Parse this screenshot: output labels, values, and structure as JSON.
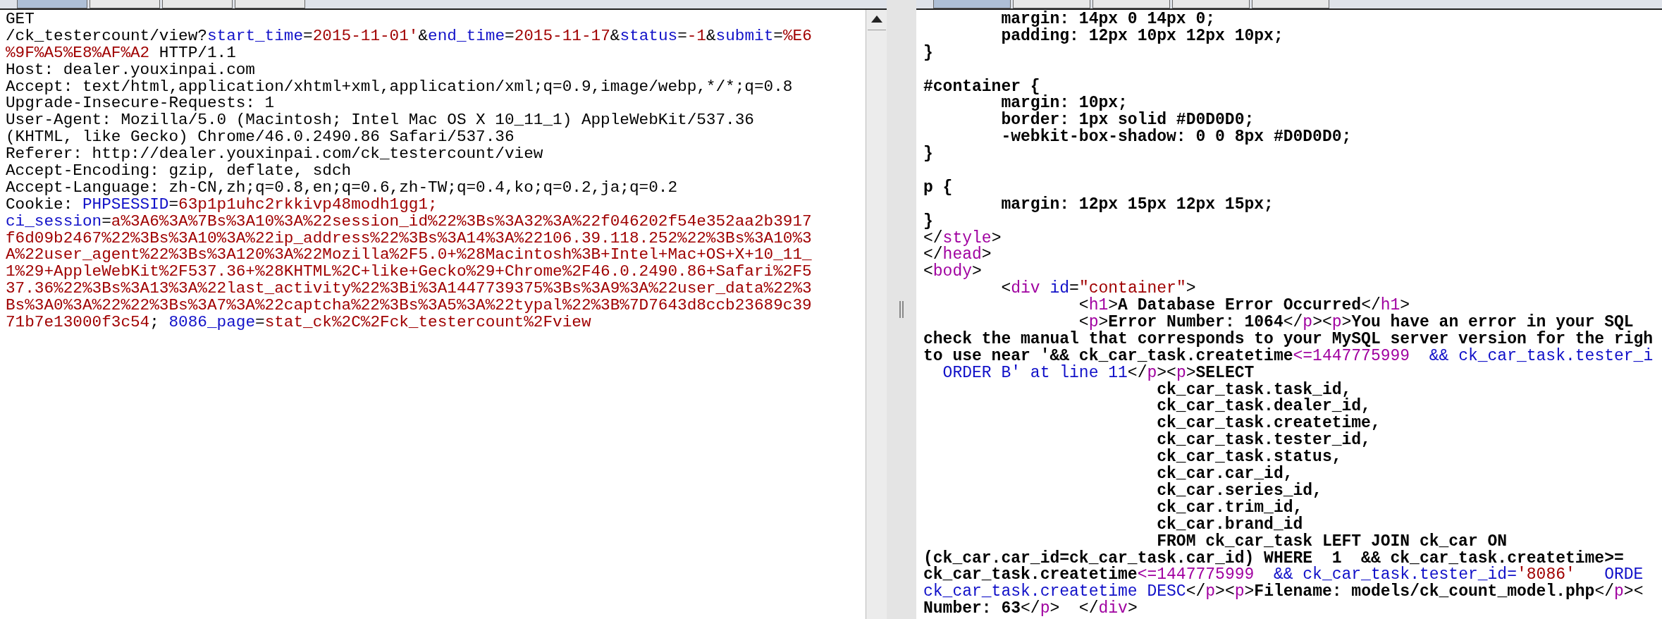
{
  "request_pane": {
    "tabs": [
      {
        "selected": true
      },
      {
        "selected": false
      },
      {
        "selected": false
      },
      {
        "selected": false
      }
    ],
    "lines": [
      {
        "segments": [
          {
            "kind": "text",
            "text": "GET"
          }
        ]
      },
      {
        "segments": [
          {
            "kind": "text",
            "text": "/ck_testercount/view?"
          },
          {
            "kind": "name",
            "text": "start_time"
          },
          {
            "kind": "text",
            "text": "="
          },
          {
            "kind": "value",
            "text": "2015-11-01'"
          },
          {
            "kind": "text",
            "text": "&"
          },
          {
            "kind": "name",
            "text": "end_time"
          },
          {
            "kind": "text",
            "text": "="
          },
          {
            "kind": "value",
            "text": "2015-11-17"
          },
          {
            "kind": "text",
            "text": "&"
          },
          {
            "kind": "name",
            "text": "status"
          },
          {
            "kind": "text",
            "text": "="
          },
          {
            "kind": "value",
            "text": "-1"
          },
          {
            "kind": "text",
            "text": "&"
          },
          {
            "kind": "name",
            "text": "submit"
          },
          {
            "kind": "text",
            "text": "="
          },
          {
            "kind": "value",
            "text": "%E6"
          }
        ]
      },
      {
        "segments": [
          {
            "kind": "value",
            "text": "%9F%A5%E8%AF%A2"
          },
          {
            "kind": "text",
            "text": " HTTP/1.1"
          }
        ]
      },
      {
        "segments": [
          {
            "kind": "text",
            "text": "Host: dealer.youxinpai.com"
          }
        ]
      },
      {
        "segments": [
          {
            "kind": "text",
            "text": "Accept: text/html,application/xhtml+xml,application/xml;q=0.9,image/webp,*/*;q=0.8"
          }
        ]
      },
      {
        "segments": [
          {
            "kind": "text",
            "text": "Upgrade-Insecure-Requests: 1"
          }
        ]
      },
      {
        "segments": [
          {
            "kind": "text",
            "text": "User-Agent: Mozilla/5.0 (Macintosh; Intel Mac OS X 10_11_1) AppleWebKit/537.36"
          }
        ]
      },
      {
        "segments": [
          {
            "kind": "text",
            "text": "(KHTML, like Gecko) Chrome/46.0.2490.86 Safari/537.36"
          }
        ]
      },
      {
        "segments": [
          {
            "kind": "text",
            "text": "Referer: http://dealer.youxinpai.com/ck_testercount/view"
          }
        ]
      },
      {
        "segments": [
          {
            "kind": "text",
            "text": "Accept-Encoding: gzip, deflate, sdch"
          }
        ]
      },
      {
        "segments": [
          {
            "kind": "text",
            "text": "Accept-Language: zh-CN,zh;q=0.8,en;q=0.6,zh-TW;q=0.4,ko;q=0.2,ja;q=0.2"
          }
        ]
      },
      {
        "segments": [
          {
            "kind": "text",
            "text": "Cookie: "
          },
          {
            "kind": "name",
            "text": "PHPSESSID"
          },
          {
            "kind": "text",
            "text": "="
          },
          {
            "kind": "value",
            "text": "63p1p1uhc2rkkivp48modh1gg1;"
          }
        ]
      },
      {
        "segments": [
          {
            "kind": "name",
            "text": "ci_session"
          },
          {
            "kind": "text",
            "text": "="
          },
          {
            "kind": "value",
            "text": "a%3A6%3A%7Bs%3A10%3A%22session_id%22%3Bs%3A32%3A%22f046202f54e352aa2b3917"
          }
        ]
      },
      {
        "segments": [
          {
            "kind": "value",
            "text": "f6d09b2467%22%3Bs%3A10%3A%22ip_address%22%3Bs%3A14%3A%22106.39.118.252%22%3Bs%3A10%3"
          }
        ]
      },
      {
        "segments": [
          {
            "kind": "value",
            "text": "A%22user_agent%22%3Bs%3A120%3A%22Mozilla%2F5.0+%28Macintosh%3B+Intel+Mac+OS+X+10_11_"
          }
        ]
      },
      {
        "segments": [
          {
            "kind": "value",
            "text": "1%29+AppleWebKit%2F537.36+%28KHTML%2C+like+Gecko%29+Chrome%2F46.0.2490.86+Safari%2F5"
          }
        ]
      },
      {
        "segments": [
          {
            "kind": "value",
            "text": "37.36%22%3Bs%3A13%3A%22last_activity%22%3Bi%3A1447739375%3Bs%3A9%3A%22user_data%22%3"
          }
        ]
      },
      {
        "segments": [
          {
            "kind": "value",
            "text": "Bs%3A0%3A%22%22%3Bs%3A7%3A%22captcha%22%3Bs%3A5%3A%22typal%22%3B%7D7643d8ccb23689c39"
          }
        ]
      },
      {
        "segments": [
          {
            "kind": "value",
            "text": "71b7e13000f3c54"
          },
          {
            "kind": "text",
            "text": "; "
          },
          {
            "kind": "name",
            "text": "8086_page"
          },
          {
            "kind": "text",
            "text": "="
          },
          {
            "kind": "value",
            "text": "stat_ck%2C%2Fck_testercount%2Fview"
          }
        ]
      }
    ]
  },
  "response_pane": {
    "tabs": [
      {
        "selected": true
      },
      {
        "selected": false
      },
      {
        "selected": false
      },
      {
        "selected": false
      },
      {
        "selected": false
      }
    ],
    "lines": [
      {
        "segments": [
          {
            "kind": "bold",
            "text": "        margin: 14px 0 14px 0;"
          }
        ]
      },
      {
        "segments": [
          {
            "kind": "bold",
            "text": "        padding: 12px 10px 12px 10px;"
          }
        ]
      },
      {
        "segments": [
          {
            "kind": "bold",
            "text": "}"
          }
        ]
      },
      {
        "space_before": true,
        "segments": [
          {
            "kind": "bold",
            "text": "#container {"
          }
        ]
      },
      {
        "segments": [
          {
            "kind": "bold",
            "text": "        margin: 10px;"
          }
        ]
      },
      {
        "segments": [
          {
            "kind": "bold",
            "text": "        border: 1px solid #D0D0D0;"
          }
        ]
      },
      {
        "segments": [
          {
            "kind": "bold",
            "text": "        -webkit-box-shadow: 0 0 8px #D0D0D0;"
          }
        ]
      },
      {
        "segments": [
          {
            "kind": "bold",
            "text": "}"
          }
        ]
      },
      {
        "space_before": true,
        "segments": [
          {
            "kind": "bold",
            "text": "p {"
          }
        ]
      },
      {
        "segments": [
          {
            "kind": "bold",
            "text": "        margin: 12px 15px 12px 15px;"
          }
        ]
      },
      {
        "segments": [
          {
            "kind": "bold",
            "text": "}"
          }
        ]
      },
      {
        "segments": [
          {
            "kind": "text",
            "text": "</"
          },
          {
            "kind": "tag",
            "text": "style"
          },
          {
            "kind": "text",
            "text": ">"
          }
        ]
      },
      {
        "segments": [
          {
            "kind": "text",
            "text": "</"
          },
          {
            "kind": "tag",
            "text": "head"
          },
          {
            "kind": "text",
            "text": ">"
          }
        ]
      },
      {
        "segments": [
          {
            "kind": "text",
            "text": "<"
          },
          {
            "kind": "tag",
            "text": "body"
          },
          {
            "kind": "text",
            "text": ">"
          }
        ]
      },
      {
        "segments": [
          {
            "kind": "text",
            "text": "        <"
          },
          {
            "kind": "tag",
            "text": "div"
          },
          {
            "kind": "name",
            "text": " id"
          },
          {
            "kind": "text",
            "text": "="
          },
          {
            "kind": "value",
            "text": "\"container\""
          },
          {
            "kind": "text",
            "text": ">"
          }
        ]
      },
      {
        "segments": [
          {
            "kind": "text",
            "text": "                <"
          },
          {
            "kind": "tag",
            "text": "h1"
          },
          {
            "kind": "text",
            "text": ">"
          },
          {
            "kind": "bold",
            "text": "A Database Error Occurred"
          },
          {
            "kind": "text",
            "text": "</"
          },
          {
            "kind": "tag",
            "text": "h1"
          },
          {
            "kind": "text",
            "text": ">"
          }
        ]
      },
      {
        "segments": [
          {
            "kind": "text",
            "text": "                <"
          },
          {
            "kind": "tag",
            "text": "p"
          },
          {
            "kind": "text",
            "text": ">"
          },
          {
            "kind": "bold",
            "text": "Error Number: 1064"
          },
          {
            "kind": "text",
            "text": "</"
          },
          {
            "kind": "tag",
            "text": "p"
          },
          {
            "kind": "text",
            "text": "><"
          },
          {
            "kind": "tag",
            "text": "p"
          },
          {
            "kind": "text",
            "text": ">"
          },
          {
            "kind": "bold",
            "text": "You have an error in your SQL"
          }
        ]
      },
      {
        "segments": [
          {
            "kind": "bold",
            "text": "check the manual that corresponds to your MySQL server version for the righ"
          }
        ]
      },
      {
        "segments": [
          {
            "kind": "bold",
            "text": "to use near '&& ck_car_task.createtime"
          },
          {
            "kind": "tag",
            "text": "<=1447775999"
          },
          {
            "kind": "name",
            "text": "  && ck_car_task.tester_i"
          }
        ]
      },
      {
        "segments": [
          {
            "kind": "name",
            "text": "  ORDER B' at line 11"
          },
          {
            "kind": "text",
            "text": "</"
          },
          {
            "kind": "tag",
            "text": "p"
          },
          {
            "kind": "text",
            "text": "><"
          },
          {
            "kind": "tag",
            "text": "p"
          },
          {
            "kind": "text",
            "text": ">"
          },
          {
            "kind": "bold",
            "text": "SELECT"
          }
        ]
      },
      {
        "segments": [
          {
            "kind": "bold",
            "text": "                        ck_car_task.task_id,"
          }
        ]
      },
      {
        "segments": [
          {
            "kind": "bold",
            "text": "                        ck_car_task.dealer_id,"
          }
        ]
      },
      {
        "segments": [
          {
            "kind": "bold",
            "text": "                        ck_car_task.createtime,"
          }
        ]
      },
      {
        "segments": [
          {
            "kind": "bold",
            "text": "                        ck_car_task.tester_id,"
          }
        ]
      },
      {
        "segments": [
          {
            "kind": "bold",
            "text": "                        ck_car_task.status,"
          }
        ]
      },
      {
        "segments": [
          {
            "kind": "bold",
            "text": "                        ck_car.car_id,"
          }
        ]
      },
      {
        "segments": [
          {
            "kind": "bold",
            "text": "                        ck_car.series_id,"
          }
        ]
      },
      {
        "segments": [
          {
            "kind": "bold",
            "text": "                        ck_car.trim_id,"
          }
        ]
      },
      {
        "segments": [
          {
            "kind": "bold",
            "text": "                        ck_car.brand_id"
          }
        ]
      },
      {
        "segments": [
          {
            "kind": "bold",
            "text": "                        FROM ck_car_task LEFT JOIN ck_car ON"
          }
        ]
      },
      {
        "segments": [
          {
            "kind": "bold",
            "text": "(ck_car.car_id=ck_car_task.car_id) WHERE  1  && ck_car_task.createtime>="
          }
        ]
      },
      {
        "segments": [
          {
            "kind": "bold",
            "text": "ck_car_task.createtime"
          },
          {
            "kind": "tag",
            "text": "<=1447775999"
          },
          {
            "kind": "name",
            "text": "  && ck_car_task.tester_id="
          },
          {
            "kind": "value",
            "text": "'8086'"
          },
          {
            "kind": "name",
            "text": "   ORDE"
          }
        ]
      },
      {
        "segments": [
          {
            "kind": "name",
            "text": "ck_car_task.createtime DESC"
          },
          {
            "kind": "text",
            "text": "</"
          },
          {
            "kind": "tag",
            "text": "p"
          },
          {
            "kind": "text",
            "text": "><"
          },
          {
            "kind": "tag",
            "text": "p"
          },
          {
            "kind": "text",
            "text": ">"
          },
          {
            "kind": "bold",
            "text": "Filename: models/ck_count_model.php"
          },
          {
            "kind": "text",
            "text": "</"
          },
          {
            "kind": "tag",
            "text": "p"
          },
          {
            "kind": "text",
            "text": "><"
          }
        ]
      },
      {
        "segments": [
          {
            "kind": "bold",
            "text": "Number: 63"
          },
          {
            "kind": "text",
            "text": "</"
          },
          {
            "kind": "tag",
            "text": "p"
          },
          {
            "kind": "text",
            "text": ">  </"
          },
          {
            "kind": "tag",
            "text": "div"
          },
          {
            "kind": "text",
            "text": ">"
          }
        ]
      }
    ]
  }
}
